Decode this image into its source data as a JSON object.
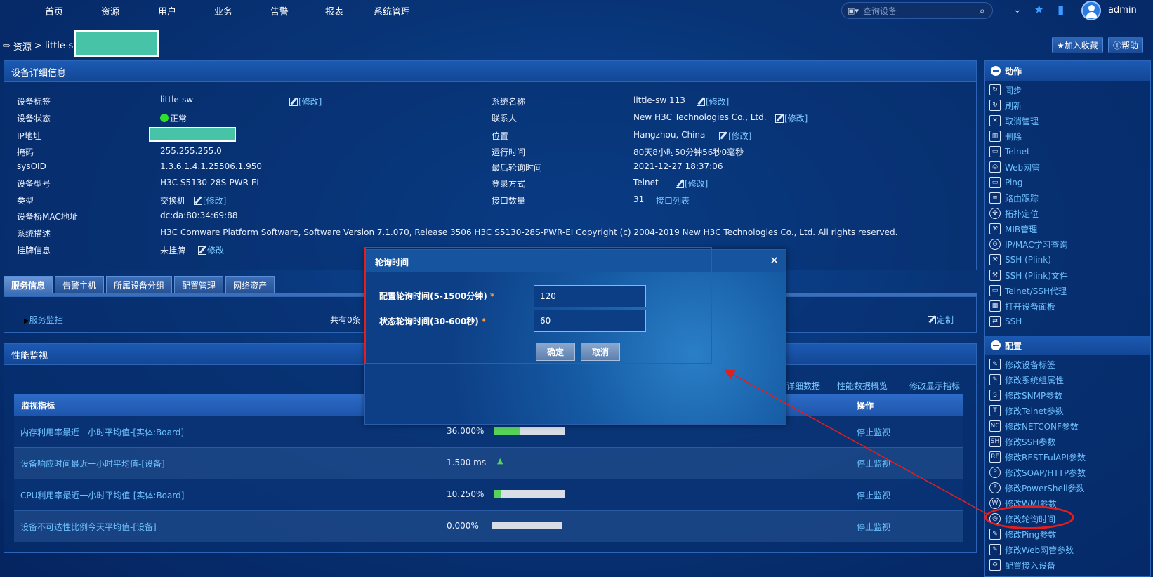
{
  "topnav": {
    "items": [
      "首页",
      "资源",
      "用户",
      "业务",
      "告警",
      "报表",
      "系统管理"
    ],
    "search_placeholder": "查询设备",
    "username": "admin"
  },
  "breadcrumb": {
    "section": "资源",
    "separator": ">",
    "device": "little-sv"
  },
  "buttons": {
    "favorite": "加入收藏",
    "help": "帮助"
  },
  "device_panel": {
    "title": "设备详细信息",
    "edit_label": "[修改]",
    "edit_plain": "修改",
    "left": [
      {
        "label": "设备标签",
        "value": "little-sw"
      },
      {
        "label": "设备状态",
        "value": "正常"
      },
      {
        "label": "IP地址",
        "value": ""
      },
      {
        "label": "掩码",
        "value": "255.255.255.0"
      },
      {
        "label": "sysOID",
        "value": "1.3.6.1.4.1.25506.1.950"
      },
      {
        "label": "设备型号",
        "value": "H3C S5130-28S-PWR-EI"
      },
      {
        "label": "类型",
        "value": "交换机"
      },
      {
        "label": "设备桥MAC地址",
        "value": "dc:da:80:34:69:88"
      },
      {
        "label": "系统描述",
        "value": "H3C Comware Platform Software, Software Version 7.1.070, Release 3506 H3C S5130-28S-PWR-EI Copyright (c) 2004-2019 New H3C Technologies Co., Ltd. All rights reserved."
      },
      {
        "label": "挂牌信息",
        "value": "未挂牌"
      }
    ],
    "right": [
      {
        "label": "系统名称",
        "value": "little-sw 113"
      },
      {
        "label": "联系人",
        "value": "New H3C Technologies Co., Ltd."
      },
      {
        "label": "位置",
        "value": "Hangzhou, China"
      },
      {
        "label": "运行时间",
        "value": "80天8小时50分钟56秒0毫秒"
      },
      {
        "label": "最后轮询时间",
        "value": "2021-12-27 18:37:06"
      },
      {
        "label": "登录方式",
        "value": "Telnet"
      },
      {
        "label": "接口数量",
        "value": "31"
      }
    ],
    "interface_list_link": "接口列表"
  },
  "tabs": [
    "服务信息",
    "告警主机",
    "所属设备分组",
    "配置管理",
    "网络资产"
  ],
  "service": {
    "monitor_link": "服务监控",
    "count_text": "共有0条",
    "customize": "定制"
  },
  "perf_panel": {
    "title": "性能监视",
    "links": [
      "详细数据",
      "性能数据概览",
      "修改显示指标"
    ],
    "columns": {
      "metric": "监视指标",
      "action": "操作"
    },
    "rows": [
      {
        "metric": "内存利用率最近一小时平均值-[实体:Board]",
        "value": "36.000%",
        "level": 0.36,
        "action": "停止监视"
      },
      {
        "metric": "设备响应时间最近一小时平均值-[设备]",
        "value": "1.500 ms",
        "level": null,
        "action": "停止监视"
      },
      {
        "metric": "CPU利用率最近一小时平均值-[实体:Board]",
        "value": "10.250%",
        "level": 0.1025,
        "action": "停止监视"
      },
      {
        "metric": "设备不可达性比例今天平均值-[设备]",
        "value": "0.000%",
        "level": 0.0,
        "action": "停止监视"
      }
    ]
  },
  "sidebar": {
    "actions_title": "动作",
    "actions": [
      "同步",
      "刷新",
      "取消管理",
      "删除",
      "Telnet",
      "Web网管",
      "Ping",
      "路由跟踪",
      "拓扑定位",
      "MIB管理",
      "IP/MAC学习查询",
      "SSH (Plink)",
      "SSH (Plink)文件",
      "Telnet/SSH代理",
      "打开设备面板",
      "SSH"
    ],
    "config_title": "配置",
    "config": [
      "修改设备标签",
      "修改系统组属性",
      "修改SNMP参数",
      "修改Telnet参数",
      "修改NETCONF参数",
      "修改SSH参数",
      "修改RESTFulAPI参数",
      "修改SOAP/HTTP参数",
      "修改PowerShell参数",
      "修改WMI参数",
      "修改轮询时间",
      "修改Ping参数",
      "修改Web网管参数",
      "配置接入设备"
    ]
  },
  "dialog": {
    "title": "轮询时间",
    "field1_label": "配置轮询时间(5-1500分钟)",
    "field1_value": "120",
    "field2_label": "状态轮询时间(30-600秒)",
    "field2_value": "60",
    "required_mark": "*",
    "ok": "确定",
    "cancel": "取消"
  },
  "colors": {
    "accent_red": "#e31e1e",
    "link": "#6ec0ff",
    "status_green": "#2fe02f"
  }
}
